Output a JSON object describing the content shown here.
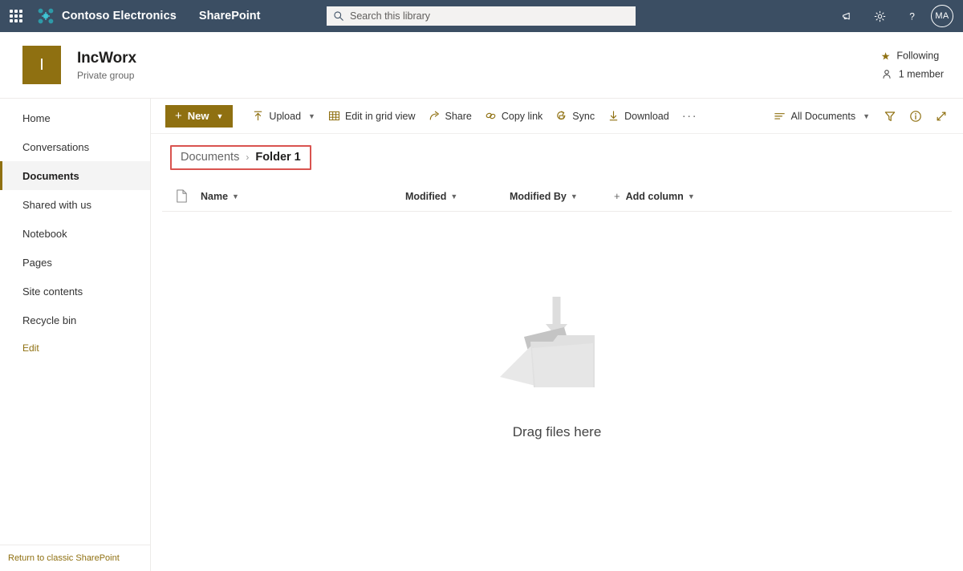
{
  "suite": {
    "waffle_label": "app-launcher",
    "brand_name": "Contoso Electronics",
    "app_name": "SharePoint",
    "search_placeholder": "Search this library",
    "search_value": "",
    "avatar_initials": "MA",
    "icons": {
      "waffle": "waffle-icon",
      "search": "search-icon",
      "announcement": "megaphone-icon",
      "settings": "gear-icon",
      "help": "question-mark-icon"
    },
    "bar_color": "#3b4e63"
  },
  "site": {
    "logo_letter": "I",
    "logo_color": "#8f7011",
    "title": "IncWorx",
    "subtitle": "Private group",
    "following_label": "Following",
    "members_label": "1 member",
    "star_color": "#8f7011"
  },
  "sidebar": {
    "items": [
      {
        "label": "Home",
        "selected": false
      },
      {
        "label": "Conversations",
        "selected": false
      },
      {
        "label": "Documents",
        "selected": true
      },
      {
        "label": "Shared with us",
        "selected": false
      },
      {
        "label": "Notebook",
        "selected": false
      },
      {
        "label": "Pages",
        "selected": false
      },
      {
        "label": "Site contents",
        "selected": false
      },
      {
        "label": "Recycle bin",
        "selected": false
      }
    ],
    "edit_label": "Edit",
    "footer_label": "Return to classic SharePoint",
    "accent_color": "#8f7011"
  },
  "commandbar": {
    "new_label": "New",
    "upload_label": "Upload",
    "edit_grid_label": "Edit in grid view",
    "share_label": "Share",
    "copy_link_label": "Copy link",
    "sync_label": "Sync",
    "download_label": "Download",
    "overflow_label": "···",
    "view_label": "All Documents",
    "icons": {
      "new": "plus-icon",
      "upload": "upload-arrow-icon",
      "edit_grid": "grid-icon",
      "share": "share-icon",
      "copy_link": "link-icon",
      "sync": "sync-icon",
      "download": "download-arrow-icon",
      "view_list": "list-view-icon",
      "filter": "filter-funnel-icon",
      "info": "info-circle-icon",
      "expand": "expand-diagonal-icon"
    }
  },
  "breadcrumb": {
    "parent": "Documents",
    "separator": "›",
    "current": "Folder 1",
    "highlight_color": "#d9534f"
  },
  "columns": {
    "file_icon": "document-icon",
    "headers": [
      {
        "label": "Name"
      },
      {
        "label": "Modified"
      },
      {
        "label": "Modified By"
      },
      {
        "label": "Add column"
      }
    ],
    "chevron": "⌄"
  },
  "empty_state": {
    "illustration": "folder-drop-illustration",
    "text": "Drag files here"
  }
}
